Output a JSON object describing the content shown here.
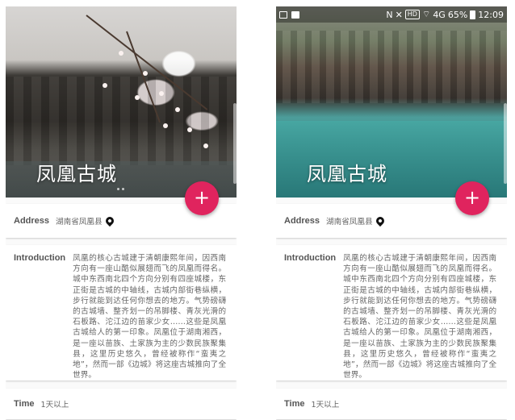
{
  "screens": [
    {
      "title": "凤凰古城",
      "fab_label": "+",
      "address": {
        "label": "Address",
        "value": "湖南省凤凰县",
        "icon": "location-pin-icon"
      },
      "introduction": {
        "label": "Introduction",
        "text": "凤凰的核心古城建于清朝康熙年间，因西南方向有一座山酷似展翅而飞的凤凰而得名。城中东西南北四个方向分别有四座城楼，东正街是古城的中轴线，古城内部街巷纵横，步行就能到达任何你想去的地方。气势磅礴的古城墙、整齐划一的吊脚楼、青灰光滑的石板路、沱江边的苗家少女……这些是凤凰古城给人的第一印象。凤凰位于湖南湘西，是一座以苗族、土家族为主的少数民族聚集县，这里历史悠久，曾经被称作“蛮夷之地”，然而一部《边城》将这座古城推向了全世界。"
      },
      "time": {
        "label": "Time",
        "value": "1天以上"
      }
    },
    {
      "title": "凤凰古城",
      "fab_label": "+",
      "status_bar": {
        "network": "4G",
        "battery": "65%",
        "clock": "12:09",
        "hd_badge": "HD"
      },
      "address": {
        "label": "Address",
        "value": "湖南省凤凰县",
        "icon": "location-pin-icon"
      },
      "introduction": {
        "label": "Introduction",
        "text": "凤凰的核心古城建于清朝康熙年间，因西南方向有一座山酷似展翅而飞的凤凰而得名。城中东西南北四个方向分别有四座城楼，东正街是古城的中轴线，古城内部街巷纵横，步行就能到达任何你想去的地方。气势磅礴的古城墙、整齐划一的吊脚楼、青灰光滑的石板路、沱江边的苗家少女……这些是凤凰古城给人的第一印象。凤凰位于湖南湘西，是一座以苗族、土家族为主的少数民族聚集县，这里历史悠久，曾经被称作“蛮夷之地”，然而一部《边城》将这座古城推向了全世界。"
      },
      "time": {
        "label": "Time",
        "value": "1天以上"
      }
    }
  ],
  "colors": {
    "fab": "#e0245e",
    "card": "#ffffff",
    "background": "#fafafa"
  }
}
